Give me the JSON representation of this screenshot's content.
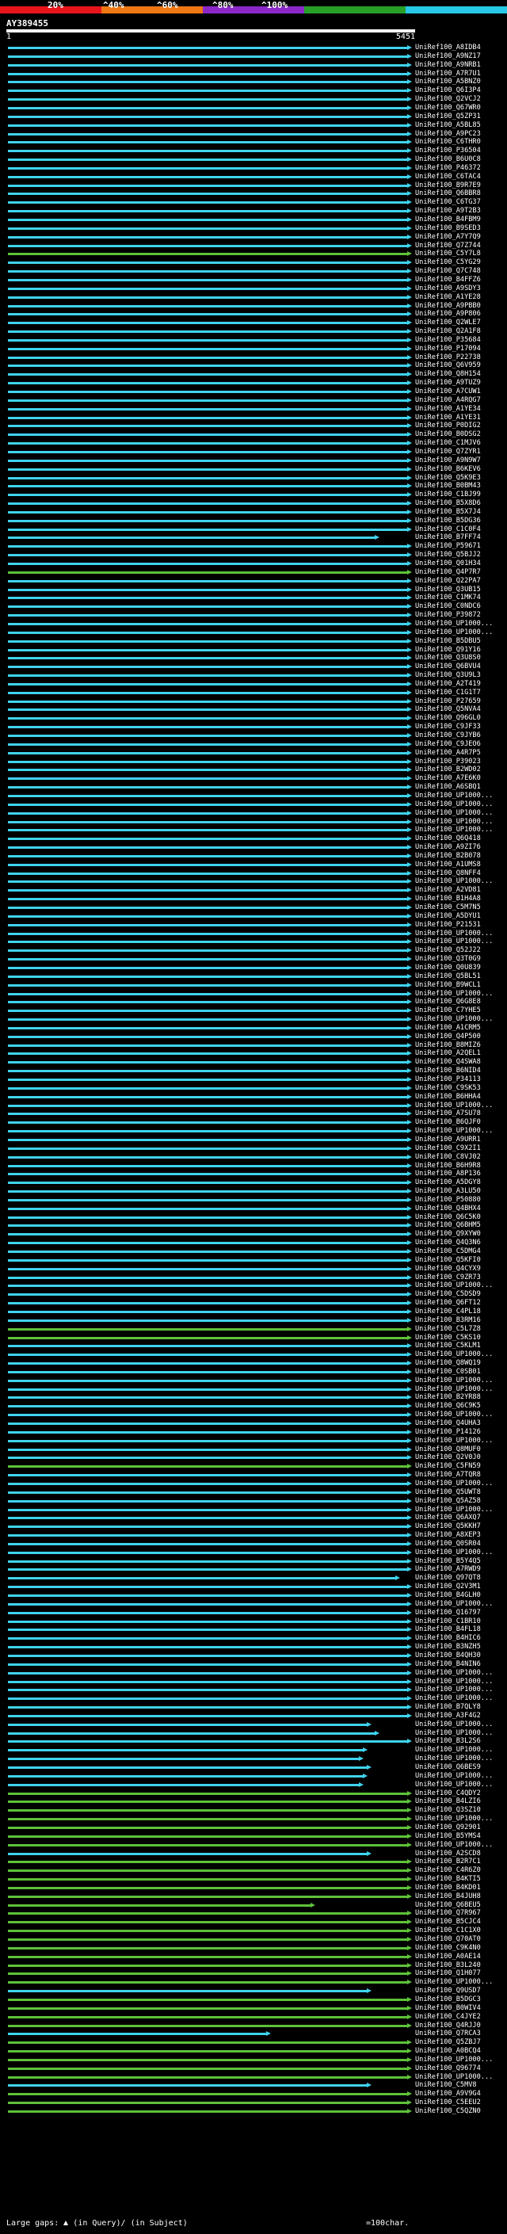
{
  "scale": {
    "segments": [
      {
        "label": "20%",
        "color": "#e8141c"
      },
      {
        "label": "^40%",
        "color": "#f07814"
      },
      {
        "label": "^60%",
        "color": "#8c28c8"
      },
      {
        "label": "^80%",
        "color": "#28a028"
      },
      {
        "label": "^100%",
        "color": "#28c8e6"
      }
    ]
  },
  "query": {
    "id": "AY389455",
    "start": "1",
    "end": "5451"
  },
  "colors": {
    "cyan": "#3fd3ee",
    "green": "#5ec23a",
    "dark_green": "#2a8c16",
    "gap": "#ffffff"
  },
  "hits": [
    {
      "label": "UniRef100_A8IDB4",
      "c": "c",
      "e": 1.0
    },
    {
      "label": "UniRef100_A9NZ17",
      "c": "c",
      "e": 1.0
    },
    {
      "label": "UniRef100_A9NRB1",
      "c": "c",
      "e": 1.0
    },
    {
      "label": "UniRef100_A7R7U1",
      "c": "c",
      "e": 1.0
    },
    {
      "label": "UniRef100_A5BNZ0",
      "c": "c",
      "e": 1.0
    },
    {
      "label": "UniRef100_Q6I3P4",
      "c": "c",
      "e": 1.0
    },
    {
      "label": "UniRef100_Q2VCJ2",
      "c": "c",
      "e": 1.0
    },
    {
      "label": "UniRef100_Q67WR0",
      "c": "c",
      "e": 1.0
    },
    {
      "label": "UniRef100_Q5ZP31",
      "c": "c",
      "e": 1.0
    },
    {
      "label": "UniRef100_A5BL85",
      "c": "c",
      "e": 1.0
    },
    {
      "label": "UniRef100_A9PC23",
      "c": "c",
      "e": 1.0
    },
    {
      "label": "UniRef100_C6THR0",
      "c": "c",
      "e": 1.0
    },
    {
      "label": "UniRef100_P36504",
      "c": "c",
      "e": 1.0
    },
    {
      "label": "UniRef100_B6U0C8",
      "c": "c",
      "e": 1.0
    },
    {
      "label": "UniRef100_P46372",
      "c": "c",
      "e": 1.0
    },
    {
      "label": "UniRef100_C6TAC4",
      "c": "c",
      "e": 1.0
    },
    {
      "label": "UniRef100_B9R7E9",
      "c": "c",
      "e": 1.0
    },
    {
      "label": "UniRef100_Q6BBR8",
      "c": "c",
      "e": 1.0
    },
    {
      "label": "UniRef100_C6TG37",
      "c": "c",
      "e": 1.0
    },
    {
      "label": "UniRef100_A9T2B3",
      "c": "c",
      "e": 1.0
    },
    {
      "label": "UniRef100_B4FBM9",
      "c": "c",
      "e": 1.0
    },
    {
      "label": "UniRef100_B9SED3",
      "c": "c",
      "e": 1.0
    },
    {
      "label": "UniRef100_A7Y7Q9",
      "c": "c",
      "e": 1.0
    },
    {
      "label": "UniRef100_Q7Z744",
      "c": "c",
      "e": 1.0
    },
    {
      "label": "UniRef100_C5Y7L8",
      "c": "g",
      "e": 1.0
    },
    {
      "label": "UniRef100_C5YG29",
      "c": "c",
      "e": 1.0
    },
    {
      "label": "UniRef100_Q7C748",
      "c": "c",
      "e": 1.0
    },
    {
      "label": "UniRef100_B4FFZ6",
      "c": "c",
      "e": 1.0
    },
    {
      "label": "UniRef100_A9SDY3",
      "c": "c",
      "e": 1.0
    },
    {
      "label": "UniRef100_A1YE28",
      "c": "c",
      "e": 1.0
    },
    {
      "label": "UniRef100_A9PBB0",
      "c": "c",
      "e": 1.0
    },
    {
      "label": "UniRef100_A9P806",
      "c": "c",
      "e": 1.0
    },
    {
      "label": "UniRef100_Q2WLE7",
      "c": "c",
      "e": 1.0
    },
    {
      "label": "UniRef100_Q2A1F8",
      "c": "c",
      "e": 1.0
    },
    {
      "label": "UniRef100_P35684",
      "c": "c",
      "e": 1.0
    },
    {
      "label": "UniRef100_P17094",
      "c": "c",
      "e": 1.0
    },
    {
      "label": "UniRef100_P22738",
      "c": "c",
      "e": 1.0
    },
    {
      "label": "UniRef100_Q6V959",
      "c": "c",
      "e": 1.0
    },
    {
      "label": "UniRef100_Q8H154",
      "c": "c",
      "e": 1.0
    },
    {
      "label": "UniRef100_A9TUZ9",
      "c": "c",
      "e": 1.0
    },
    {
      "label": "UniRef100_A7CUW1",
      "c": "c",
      "e": 1.0
    },
    {
      "label": "UniRef100_A4RQG7",
      "c": "c",
      "e": 1.0
    },
    {
      "label": "UniRef100_A1YE34",
      "c": "c",
      "e": 1.0
    },
    {
      "label": "UniRef100_A1YE31",
      "c": "c",
      "e": 1.0
    },
    {
      "label": "UniRef100_P0DIG2",
      "c": "c",
      "e": 1.0
    },
    {
      "label": "UniRef100_B0DSG2",
      "c": "c",
      "e": 1.0
    },
    {
      "label": "UniRef100_C1MJV6",
      "c": "c",
      "e": 1.0
    },
    {
      "label": "UniRef100_Q7ZYR1",
      "c": "c",
      "e": 1.0
    },
    {
      "label": "UniRef100_A9N9W7",
      "c": "c",
      "e": 1.0
    },
    {
      "label": "UniRef100_B6KEV6",
      "c": "c",
      "e": 1.0
    },
    {
      "label": "UniRef100_Q5K9E3",
      "c": "c",
      "e": 1.0
    },
    {
      "label": "UniRef100_B0BM43",
      "c": "c",
      "e": 1.0
    },
    {
      "label": "UniRef100_C1BJ99",
      "c": "c",
      "e": 1.0
    },
    {
      "label": "UniRef100_B5X8D6",
      "c": "c",
      "e": 1.0
    },
    {
      "label": "UniRef100_B5X7J4",
      "c": "c",
      "e": 1.0
    },
    {
      "label": "UniRef100_B5DG36",
      "c": "c",
      "e": 1.0
    },
    {
      "label": "UniRef100_C1C0F4",
      "c": "c",
      "e": 1.0
    },
    {
      "label": "UniRef100_B7FF74",
      "c": "c",
      "e": 0.92
    },
    {
      "label": "UniRef100_P59671",
      "c": "c",
      "e": 1.0
    },
    {
      "label": "UniRef100_Q5BJJ2",
      "c": "c",
      "e": 1.0
    },
    {
      "label": "UniRef100_Q01H34",
      "c": "c",
      "e": 1.0
    },
    {
      "label": "UniRef100_Q4P7R7",
      "c": "g",
      "e": 1.0
    },
    {
      "label": "UniRef100_Q22PA7",
      "c": "c",
      "e": 1.0
    },
    {
      "label": "UniRef100_Q3UB15",
      "c": "c",
      "e": 1.0
    },
    {
      "label": "UniRef100_C1MK74",
      "c": "c",
      "e": 1.0
    },
    {
      "label": "UniRef100_C0NDC6",
      "c": "c",
      "e": 1.0
    },
    {
      "label": "UniRef100_P39872",
      "c": "c",
      "e": 1.0
    },
    {
      "label": "UniRef100_UP1000...",
      "c": "c",
      "e": 1.0
    },
    {
      "label": "UniRef100_UP1000...",
      "c": "c",
      "e": 1.0
    },
    {
      "label": "UniRef100_B5DBU5",
      "c": "c",
      "e": 1.0
    },
    {
      "label": "UniRef100_Q91Y16",
      "c": "c",
      "e": 1.0
    },
    {
      "label": "UniRef100_Q3U8S0",
      "c": "c",
      "e": 1.0
    },
    {
      "label": "UniRef100_Q6BVU4",
      "c": "c",
      "e": 1.0
    },
    {
      "label": "UniRef100_Q3U9L3",
      "c": "c",
      "e": 1.0
    },
    {
      "label": "UniRef100_A2T419",
      "c": "c",
      "e": 1.0
    },
    {
      "label": "UniRef100_C1G1T7",
      "c": "c",
      "e": 1.0
    },
    {
      "label": "UniRef100_P27659",
      "c": "c",
      "e": 1.0
    },
    {
      "label": "UniRef100_Q5NVA4",
      "c": "c",
      "e": 1.0
    },
    {
      "label": "UniRef100_Q96GL0",
      "c": "c",
      "e": 1.0
    },
    {
      "label": "UniRef100_C9JF33",
      "c": "c",
      "e": 1.0
    },
    {
      "label": "UniRef100_C9JYB6",
      "c": "c",
      "e": 1.0
    },
    {
      "label": "UniRef100_C9JEO6",
      "c": "c",
      "e": 1.0
    },
    {
      "label": "UniRef100_A4R7P5",
      "c": "c",
      "e": 1.0
    },
    {
      "label": "UniRef100_P39023",
      "c": "c",
      "e": 1.0
    },
    {
      "label": "UniRef100_B2WD02",
      "c": "c",
      "e": 1.0
    },
    {
      "label": "UniRef100_A7E6K0",
      "c": "c",
      "e": 1.0
    },
    {
      "label": "UniRef100_A6SBQ1",
      "c": "c",
      "e": 1.0
    },
    {
      "label": "UniRef100_UP1000...",
      "c": "c",
      "e": 1.0
    },
    {
      "label": "UniRef100_UP1000...",
      "c": "c",
      "e": 1.0
    },
    {
      "label": "UniRef100_UP1000...",
      "c": "c",
      "e": 1.0
    },
    {
      "label": "UniRef100_UP1000...",
      "c": "c",
      "e": 1.0
    },
    {
      "label": "UniRef100_UP1000...",
      "c": "c",
      "e": 1.0
    },
    {
      "label": "UniRef100_Q6Q418",
      "c": "c",
      "e": 1.0
    },
    {
      "label": "UniRef100_A9ZI76",
      "c": "c",
      "e": 1.0
    },
    {
      "label": "UniRef100_B2B078",
      "c": "c",
      "e": 1.0
    },
    {
      "label": "UniRef100_A1UMS8",
      "c": "c",
      "e": 1.0
    },
    {
      "label": "UniRef100_Q8NFF4",
      "c": "c",
      "e": 1.0
    },
    {
      "label": "UniRef100_UP1000...",
      "c": "c",
      "e": 1.0
    },
    {
      "label": "UniRef100_A2VD81",
      "c": "c",
      "e": 1.0
    },
    {
      "label": "UniRef100_B1H4A8",
      "c": "c",
      "e": 1.0
    },
    {
      "label": "UniRef100_C5M7N5",
      "c": "c",
      "e": 1.0
    },
    {
      "label": "UniRef100_A5DYU1",
      "c": "c",
      "e": 1.0
    },
    {
      "label": "UniRef100_P21531",
      "c": "c",
      "e": 1.0
    },
    {
      "label": "UniRef100_UP1000...",
      "c": "c",
      "e": 1.0
    },
    {
      "label": "UniRef100_UP1000...",
      "c": "c",
      "e": 1.0
    },
    {
      "label": "UniRef100_Q52J22",
      "c": "c",
      "e": 1.0
    },
    {
      "label": "UniRef100_Q3T0G9",
      "c": "c",
      "e": 1.0
    },
    {
      "label": "UniRef100_Q0U839",
      "c": "c",
      "e": 1.0
    },
    {
      "label": "UniRef100_Q5BL51",
      "c": "c",
      "e": 1.0
    },
    {
      "label": "UniRef100_B9WCL1",
      "c": "c",
      "e": 1.0
    },
    {
      "label": "UniRef100_UP1000...",
      "c": "c",
      "e": 1.0
    },
    {
      "label": "UniRef100_Q6G8E8",
      "c": "c",
      "e": 1.0
    },
    {
      "label": "UniRef100_C7YHE5",
      "c": "c",
      "e": 1.0
    },
    {
      "label": "UniRef100_UP1000...",
      "c": "c",
      "e": 1.0
    },
    {
      "label": "UniRef100_A1CRM5",
      "c": "c",
      "e": 1.0
    },
    {
      "label": "UniRef100_Q4P500",
      "c": "c",
      "e": 1.0
    },
    {
      "label": "UniRef100_B8MIZ6",
      "c": "c",
      "e": 1.0
    },
    {
      "label": "UniRef100_A2QEL1",
      "c": "c",
      "e": 1.0
    },
    {
      "label": "UniRef100_Q4SWA8",
      "c": "c",
      "e": 1.0
    },
    {
      "label": "UniRef100_B6NID4",
      "c": "c",
      "e": 1.0
    },
    {
      "label": "UniRef100_P34113",
      "c": "c",
      "e": 1.0
    },
    {
      "label": "UniRef100_C9SK53",
      "c": "c",
      "e": 1.0
    },
    {
      "label": "UniRef100_B6HHA4",
      "c": "c",
      "e": 1.0
    },
    {
      "label": "UniRef100_UP1000...",
      "c": "c",
      "e": 1.0
    },
    {
      "label": "UniRef100_A7SU78",
      "c": "c",
      "e": 1.0
    },
    {
      "label": "UniRef100_B6QJF0",
      "c": "c",
      "e": 1.0
    },
    {
      "label": "UniRef100_UP1000...",
      "c": "c",
      "e": 1.0
    },
    {
      "label": "UniRef100_A9URR1",
      "c": "c",
      "e": 1.0
    },
    {
      "label": "UniRef100_C9X2I1",
      "c": "c",
      "e": 1.0
    },
    {
      "label": "UniRef100_C8VJ02",
      "c": "c",
      "e": 1.0
    },
    {
      "label": "UniRef100_B6H9R8",
      "c": "c",
      "e": 1.0
    },
    {
      "label": "UniRef100_A8P136",
      "c": "c",
      "e": 1.0
    },
    {
      "label": "UniRef100_A5DGY8",
      "c": "c",
      "e": 1.0
    },
    {
      "label": "UniRef100_A3LU50",
      "c": "c",
      "e": 1.0
    },
    {
      "label": "UniRef100_P50880",
      "c": "c",
      "e": 1.0
    },
    {
      "label": "UniRef100_Q4BHX4",
      "c": "c",
      "e": 1.0
    },
    {
      "label": "UniRef100_Q6C5K0",
      "c": "c",
      "e": 1.0
    },
    {
      "label": "UniRef100_Q6BHM5",
      "c": "c",
      "e": 1.0
    },
    {
      "label": "UniRef100_Q9XYW0",
      "c": "c",
      "e": 1.0
    },
    {
      "label": "UniRef100_Q4Q3N6",
      "c": "c",
      "e": 1.0
    },
    {
      "label": "UniRef100_C5DMG4",
      "c": "c",
      "e": 1.0
    },
    {
      "label": "UniRef100_Q5KFI0",
      "c": "c",
      "e": 1.0
    },
    {
      "label": "UniRef100_Q4CYX9",
      "c": "c",
      "e": 1.0
    },
    {
      "label": "UniRef100_C9ZR73",
      "c": "c",
      "e": 1.0
    },
    {
      "label": "UniRef100_UP1000...",
      "c": "c",
      "e": 1.0
    },
    {
      "label": "UniRef100_C5DSD9",
      "c": "c",
      "e": 1.0
    },
    {
      "label": "UniRef100_Q6FT12",
      "c": "c",
      "e": 1.0
    },
    {
      "label": "UniRef100_C4PL18",
      "c": "c",
      "e": 1.0
    },
    {
      "label": "UniRef100_B3RM16",
      "c": "c",
      "e": 1.0
    },
    {
      "label": "UniRef100_C5L7Z8",
      "c": "g",
      "e": 1.0
    },
    {
      "label": "UniRef100_C5KS10",
      "c": "g",
      "e": 1.0
    },
    {
      "label": "UniRef100_C5KLM1",
      "c": "c",
      "e": 1.0
    },
    {
      "label": "UniRef100_UP1000...",
      "c": "c",
      "e": 1.0
    },
    {
      "label": "UniRef100_Q8WQ19",
      "c": "c",
      "e": 1.0
    },
    {
      "label": "UniRef100_C0SB01",
      "c": "c",
      "e": 1.0
    },
    {
      "label": "UniRef100_UP1000...",
      "c": "c",
      "e": 1.0
    },
    {
      "label": "UniRef100_UP1000...",
      "c": "c",
      "e": 1.0
    },
    {
      "label": "UniRef100_B2YR88",
      "c": "c",
      "e": 1.0
    },
    {
      "label": "UniRef100_Q6C9K5",
      "c": "c",
      "e": 1.0
    },
    {
      "label": "UniRef100_UP1000...",
      "c": "c",
      "e": 1.0
    },
    {
      "label": "UniRef100_Q4UHA3",
      "c": "c",
      "e": 1.0
    },
    {
      "label": "UniRef100_P14126",
      "c": "c",
      "e": 1.0
    },
    {
      "label": "UniRef100_UP1000...",
      "c": "c",
      "e": 1.0
    },
    {
      "label": "UniRef100_Q8MUF0",
      "c": "c",
      "e": 1.0
    },
    {
      "label": "UniRef100_Q2V0J0",
      "c": "c",
      "e": 1.0
    },
    {
      "label": "UniRef100_C5FN59",
      "c": "g",
      "e": 1.0
    },
    {
      "label": "UniRef100_A7TQR8",
      "c": "c",
      "e": 1.0
    },
    {
      "label": "UniRef100_UP1000...",
      "c": "c",
      "e": 1.0
    },
    {
      "label": "UniRef100_Q5UWT8",
      "c": "c",
      "e": 1.0
    },
    {
      "label": "UniRef100_Q5AZ58",
      "c": "c",
      "e": 1.0
    },
    {
      "label": "UniRef100_UP1000...",
      "c": "c",
      "e": 1.0
    },
    {
      "label": "UniRef100_Q6AXQ7",
      "c": "c",
      "e": 1.0
    },
    {
      "label": "UniRef100_Q5KKH7",
      "c": "c",
      "e": 1.0
    },
    {
      "label": "UniRef100_A8XEP3",
      "c": "c",
      "e": 1.0
    },
    {
      "label": "UniRef100_Q0SR04",
      "c": "c",
      "e": 1.0
    },
    {
      "label": "UniRef100_UP1000...",
      "c": "c",
      "e": 1.0
    },
    {
      "label": "UniRef100_B5Y4Q5",
      "c": "c",
      "e": 1.0
    },
    {
      "label": "UniRef100_A7RWD9",
      "c": "c",
      "e": 1.0
    },
    {
      "label": "UniRef100_Q97QT8",
      "c": "c",
      "e": 0.97
    },
    {
      "label": "UniRef100_Q2V3M1",
      "c": "c",
      "e": 1.0
    },
    {
      "label": "UniRef100_B4GLH0",
      "c": "c",
      "e": 1.0
    },
    {
      "label": "UniRef100_UP1000...",
      "c": "c",
      "e": 1.0
    },
    {
      "label": "UniRef100_Q16797",
      "c": "c",
      "e": 1.0
    },
    {
      "label": "UniRef100_C1BR10",
      "c": "c",
      "e": 1.0
    },
    {
      "label": "UniRef100_B4FL18",
      "c": "c",
      "e": 1.0
    },
    {
      "label": "UniRef100_B4HIC6",
      "c": "c",
      "e": 1.0
    },
    {
      "label": "UniRef100_B3NZH5",
      "c": "c",
      "e": 1.0
    },
    {
      "label": "UniRef100_B4QH30",
      "c": "c",
      "e": 1.0
    },
    {
      "label": "UniRef100_B4NIN6",
      "c": "c",
      "e": 1.0
    },
    {
      "label": "UniRef100_UP1000...",
      "c": "c",
      "e": 1.0
    },
    {
      "label": "UniRef100_UP1000...",
      "c": "c",
      "e": 1.0
    },
    {
      "label": "UniRef100_UP1000...",
      "c": "c",
      "e": 1.0
    },
    {
      "label": "UniRef100_UP1000...",
      "c": "c",
      "e": 1.0
    },
    {
      "label": "UniRef100_B7QLY8",
      "c": "c",
      "e": 1.0
    },
    {
      "label": "UniRef100_A3F4G2",
      "c": "c",
      "e": 1.0
    },
    {
      "label": "UniRef100_UP1000...",
      "c": "c",
      "e": 0.9
    },
    {
      "label": "UniRef100_UP1000...",
      "c": "c",
      "e": 0.92
    },
    {
      "label": "UniRef100_B3L2S6",
      "c": "c",
      "e": 1.0
    },
    {
      "label": "UniRef100_UP1000...",
      "c": "c",
      "e": 0.89
    },
    {
      "label": "UniRef100_UP1000...",
      "c": "c",
      "e": 0.88
    },
    {
      "label": "UniRef100_Q6BES9",
      "c": "c",
      "e": 0.9
    },
    {
      "label": "UniRef100_UP1000...",
      "c": "c",
      "e": 0.89
    },
    {
      "label": "UniRef100_UP1000...",
      "c": "c",
      "e": 0.88
    },
    {
      "label": "UniRef100_C4QDY2",
      "c": "g",
      "e": 1.0
    },
    {
      "label": "UniRef100_B4LZI6",
      "c": "g",
      "e": 1.0
    },
    {
      "label": "UniRef100_Q3SZ10",
      "c": "g",
      "e": 1.0
    },
    {
      "label": "UniRef100_UP1000...",
      "c": "g",
      "e": 1.0
    },
    {
      "label": "UniRef100_Q92901",
      "c": "g",
      "e": 1.0
    },
    {
      "label": "UniRef100_B5YMS4",
      "c": "g",
      "e": 1.0
    },
    {
      "label": "UniRef100_UP1000...",
      "c": "g",
      "e": 1.0
    },
    {
      "label": "UniRef100_A2SCD8",
      "c": "c",
      "e": 0.9
    },
    {
      "label": "UniRef100_B2R7C1",
      "c": "g",
      "e": 1.0
    },
    {
      "label": "UniRef100_C4R6Z0",
      "c": "g",
      "e": 1.0
    },
    {
      "label": "UniRef100_B4KTI5",
      "c": "g",
      "e": 1.0
    },
    {
      "label": "UniRef100_B4KD01",
      "c": "g",
      "e": 1.0
    },
    {
      "label": "UniRef100_B4JUH8",
      "c": "g",
      "e": 1.0
    },
    {
      "label": "UniRef100_Q6BEU5",
      "c": "g",
      "e": 0.76
    },
    {
      "label": "UniRef100_Q7R967",
      "c": "g",
      "e": 1.0
    },
    {
      "label": "UniRef100_B5CJC4",
      "c": "g",
      "e": 1.0
    },
    {
      "label": "UniRef100_C1C1X0",
      "c": "g",
      "e": 1.0
    },
    {
      "label": "UniRef100_Q70AT0",
      "c": "g",
      "e": 1.0
    },
    {
      "label": "UniRef100_C9K4N0",
      "c": "g",
      "e": 1.0
    },
    {
      "label": "UniRef100_A0AE14",
      "c": "g",
      "e": 1.0
    },
    {
      "label": "UniRef100_B3L240",
      "c": "g",
      "e": 1.0
    },
    {
      "label": "UniRef100_Q1H077",
      "c": "g",
      "e": 1.0
    },
    {
      "label": "UniRef100_UP1000...",
      "c": "g",
      "e": 1.0
    },
    {
      "label": "UniRef100_Q9USD7",
      "c": "c",
      "e": 0.9
    },
    {
      "label": "UniRef100_B5DGC3",
      "c": "g",
      "e": 1.0
    },
    {
      "label": "UniRef100_B0WIV4",
      "c": "g",
      "e": 1.0
    },
    {
      "label": "UniRef100_C4JYE2",
      "c": "g",
      "e": 1.0
    },
    {
      "label": "UniRef100_Q4RJJ0",
      "c": "g",
      "e": 1.0
    },
    {
      "label": "UniRef100_Q7RCA3",
      "c": "c",
      "e": 0.65
    },
    {
      "label": "UniRef100_Q5ZBJ7",
      "c": "g",
      "e": 1.0
    },
    {
      "label": "UniRef100_A0BCQ4",
      "c": "g",
      "e": 1.0
    },
    {
      "label": "UniRef100_UP1000...",
      "c": "g",
      "e": 1.0
    },
    {
      "label": "UniRef100_Q96774",
      "c": "g",
      "e": 1.0
    },
    {
      "label": "UniRef100_UP1000...",
      "c": "g",
      "e": 1.0
    },
    {
      "label": "UniRef100_C5MV8",
      "c": "c",
      "e": 0.9
    },
    {
      "label": "UniRef100_A9V9G4",
      "c": "g",
      "e": 1.0
    },
    {
      "label": "UniRef100_C5EEU2",
      "c": "g",
      "e": 1.0
    },
    {
      "label": "UniRef100_C5QZN0",
      "c": "g",
      "e": 1.0
    }
  ],
  "footer": {
    "large_gaps": "Large gaps:",
    "in_query": "(in Query)/",
    "in_subject": "(in Subject)",
    "scale_note": "=100char."
  }
}
